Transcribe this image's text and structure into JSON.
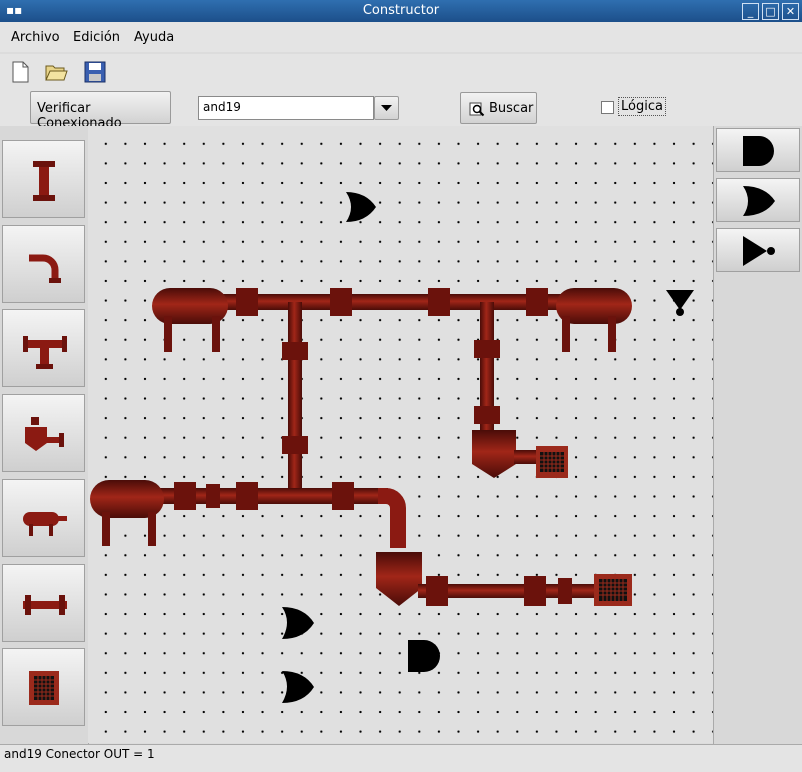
{
  "window": {
    "title": "Constructor"
  },
  "menu": {
    "items": [
      "Archivo",
      "Edición",
      "Ayuda"
    ]
  },
  "toolbar": {
    "icons": [
      "new-file-icon",
      "open-folder-icon",
      "save-disk-icon"
    ]
  },
  "controls": {
    "verify_label": "Verificar Conexionado",
    "combo_value": "and19",
    "search_label": "Buscar",
    "logic_label": "Lógica",
    "logic_checked": false
  },
  "left_palette": [
    "vertical-pipe-icon",
    "elbow-pipe-icon",
    "tee-pipe-icon",
    "valve-tank-icon",
    "tank-icon",
    "flanged-pipe-icon",
    "grate-outlet-icon"
  ],
  "right_palette": [
    "and-gate-icon",
    "or-gate-icon",
    "not-gate-icon"
  ],
  "status": {
    "text": "and19  Conector OUT = 1"
  },
  "colors": {
    "pipe": "#8b1a12",
    "pipe_dark": "#4a0c08",
    "titlebar": "#2563a8"
  }
}
